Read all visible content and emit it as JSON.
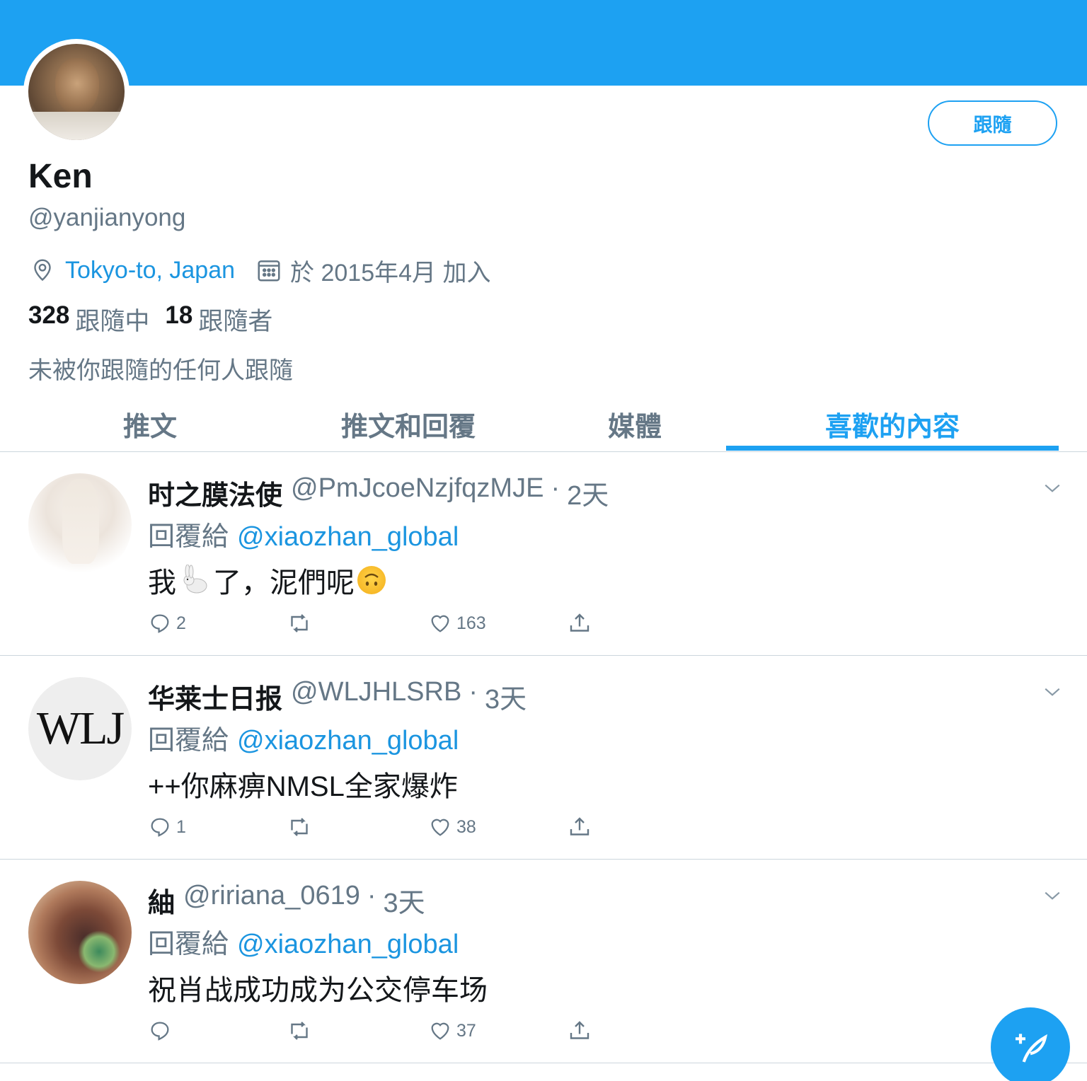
{
  "profile": {
    "display_name": "Ken",
    "handle": "@yanjianyong",
    "location": "Tokyo-to, Japan",
    "joined": "於 2015年4月 加入",
    "following_count": "328",
    "following_label": "跟隨中",
    "followers_count": "18",
    "followers_label": "跟隨者",
    "followed_by": "未被你跟隨的任何人跟隨",
    "follow_button": "跟隨"
  },
  "tabs": [
    {
      "label": "推文",
      "active": false
    },
    {
      "label": "推文和回覆",
      "active": false
    },
    {
      "label": "媒體",
      "active": false
    },
    {
      "label": "喜歡的內容",
      "active": true
    }
  ],
  "tweets": [
    {
      "name": "时之膜法使",
      "handle": "@PmJcoeNzjfqzMJE",
      "time": "2天",
      "reply_prefix": "回覆給",
      "reply_to": "@xiaozhan_global",
      "body_part1": "我",
      "body_part2": "了，泥們呢",
      "replies": "2",
      "retweets": "",
      "likes": "163"
    },
    {
      "name": "华莱士日报",
      "handle": "@WLJHLSRB",
      "time": "3天",
      "avatar_text": "WLJ",
      "reply_prefix": "回覆給",
      "reply_to": "@xiaozhan_global",
      "body": "++你麻痹NMSL全家爆炸",
      "replies": "1",
      "retweets": "",
      "likes": "38"
    },
    {
      "name": "紬",
      "handle": "@ririana_0619",
      "time": "3天",
      "reply_prefix": "回覆給",
      "reply_to": "@xiaozhan_global",
      "body": "祝肖战成功成为公交停车场",
      "replies": "",
      "retweets": "",
      "likes": "37"
    }
  ],
  "colors": {
    "accent": "#1da1f2",
    "link": "#1b95e0",
    "muted": "#657786",
    "text": "#14171a",
    "border": "#ccd6dd"
  },
  "icons": [
    "location-pin-icon",
    "calendar-icon",
    "chevron-down-icon",
    "reply-icon",
    "retweet-icon",
    "like-icon",
    "share-icon",
    "compose-tweet-icon"
  ]
}
